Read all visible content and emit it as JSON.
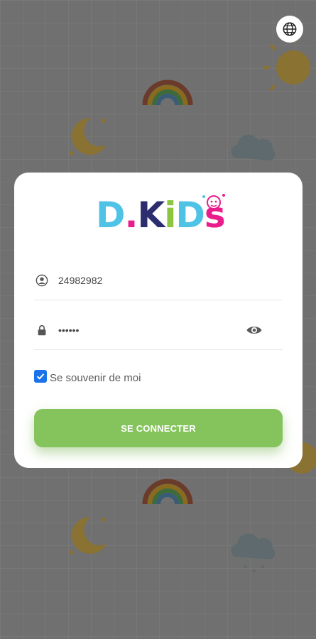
{
  "brand": {
    "letters": [
      {
        "char": "D",
        "color": "#4fc3e6"
      },
      {
        "char": ".",
        "color": "#e91e8c"
      },
      {
        "char": "K",
        "color": "#2b2d6e"
      },
      {
        "char": "i",
        "color": "#8cc63f"
      },
      {
        "char": "D",
        "color": "#4fc3e6"
      },
      {
        "char": "s",
        "color": "#e91e8c"
      }
    ]
  },
  "language_button": {
    "icon": "globe-icon"
  },
  "form": {
    "username": {
      "value": "24982982",
      "icon": "user-icon"
    },
    "password": {
      "value": "••••••",
      "icon": "lock-icon",
      "toggle_icon": "eye-icon"
    },
    "remember_me": {
      "label": "Se souvenir de moi",
      "checked": true
    },
    "submit_label": "SE CONNECTER"
  },
  "colors": {
    "primary": "#85c35d",
    "checkbox": "#1a73e8",
    "overlay": "#707070"
  }
}
